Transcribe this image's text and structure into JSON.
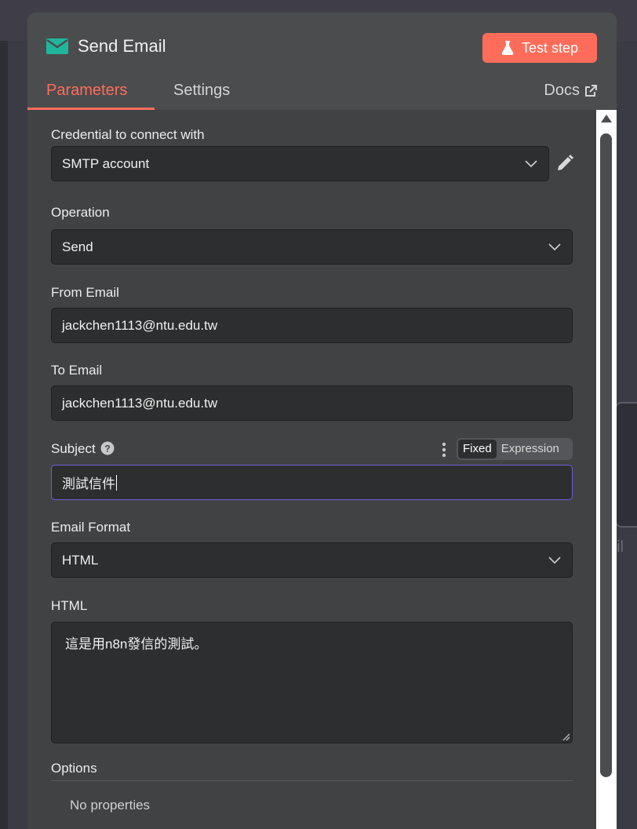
{
  "node": {
    "title": "Send Email",
    "test_button_label": "Test step"
  },
  "tabs": [
    {
      "label": "Parameters",
      "active": true
    },
    {
      "label": "Settings",
      "active": false
    }
  ],
  "docs_label": "Docs",
  "fields": {
    "credential": {
      "label": "Credential to connect with",
      "value": "SMTP account"
    },
    "operation": {
      "label": "Operation",
      "value": "Send"
    },
    "from_email": {
      "label": "From Email",
      "value": "jackchen1113@ntu.edu.tw"
    },
    "to_email": {
      "label": "To Email",
      "value": "jackchen1113@ntu.edu.tw"
    },
    "subject": {
      "label": "Subject",
      "value": "測試信件",
      "mode_options": [
        "Fixed",
        "Expression"
      ],
      "mode_selected": "Fixed"
    },
    "email_format": {
      "label": "Email Format",
      "value": "HTML"
    },
    "html": {
      "label": "HTML",
      "value": "這是用n8n發信的測試。"
    }
  },
  "options": {
    "label": "Options",
    "empty_text": "No properties"
  },
  "background": {
    "node_label_fragment": "il"
  },
  "colors": {
    "accent": "#ff6d5a",
    "mail_icon": "#20b69e",
    "focus_border": "#6b5fd6"
  }
}
